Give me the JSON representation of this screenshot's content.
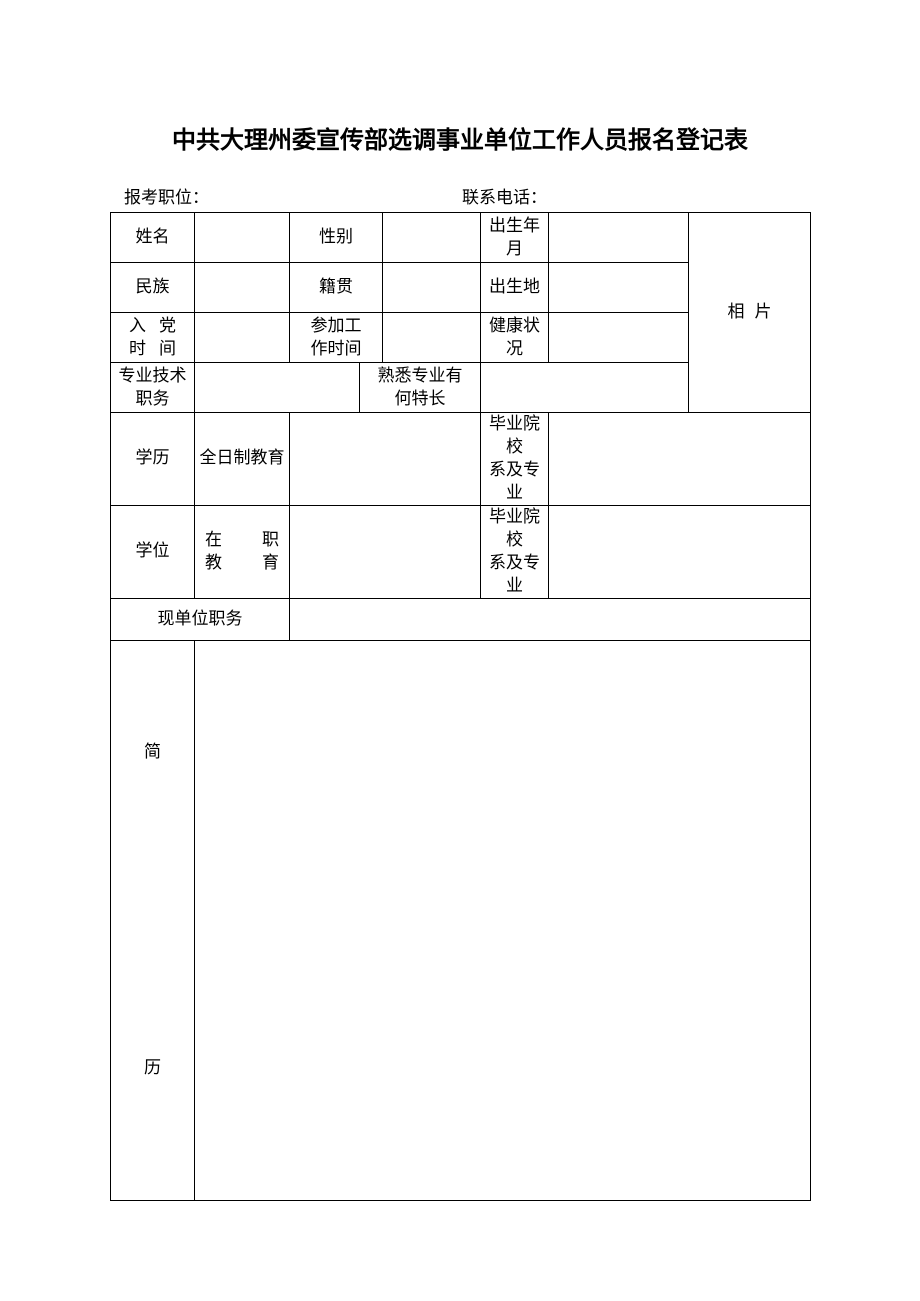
{
  "title": "中共大理州委宣传部选调事业单位工作人员报名登记表",
  "header": {
    "position_label": "报考职位：",
    "position_value": "",
    "phone_label": "联系电话：",
    "phone_value": ""
  },
  "labels": {
    "name": "姓名",
    "gender": "性别",
    "birth": "出生年月",
    "ethnic": "民族",
    "origin": "籍贯",
    "birthplace": "出生地",
    "party_a": "入",
    "party_b": "党",
    "party_c": "时",
    "party_d": "间",
    "worktime_l1": "参加工",
    "worktime_l2": "作时间",
    "health": "健康状况",
    "protitle_l1": "专业技术",
    "protitle_l2": "职务",
    "specialty_l1": "熟悉专业有",
    "specialty_l2": "何特长",
    "edu_row1": "学历",
    "edu_row2": "学位",
    "fulltime": "全日制教育",
    "onjob_a": "在",
    "onjob_b": "职",
    "onjob_c": "教",
    "onjob_d": "育",
    "gradschool_l1": "毕业院校",
    "gradschool_l2": "系及专业",
    "current_position": "现单位职务",
    "photo": "相片",
    "resume_a": "简",
    "resume_b": "历"
  },
  "values": {
    "name": "",
    "gender": "",
    "birth": "",
    "ethnic": "",
    "origin": "",
    "birthplace": "",
    "party_time": "",
    "work_time": "",
    "health": "",
    "pro_title": "",
    "specialty": "",
    "fulltime_degree": "",
    "fulltime_school": "",
    "onjob_degree": "",
    "onjob_school": "",
    "current_position": "",
    "resume": ""
  }
}
